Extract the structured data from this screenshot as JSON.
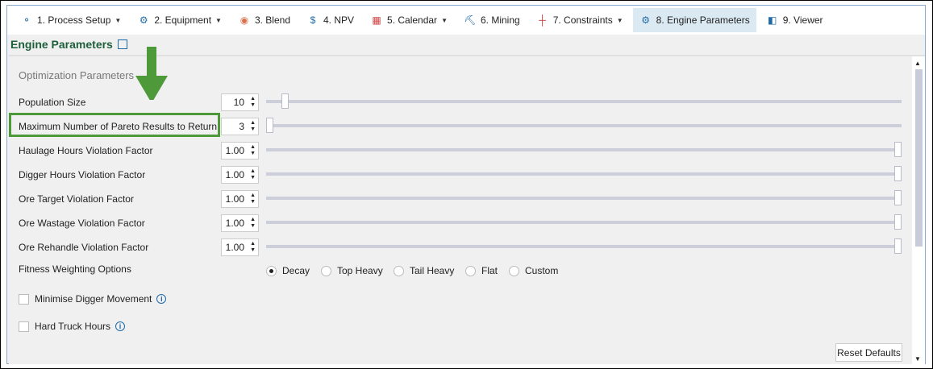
{
  "tabs": [
    {
      "label": "1. Process Setup",
      "icon": "process-icon",
      "dropdown": true
    },
    {
      "label": "2. Equipment",
      "icon": "equipment-icon",
      "dropdown": true
    },
    {
      "label": "3. Blend",
      "icon": "blend-icon",
      "dropdown": false
    },
    {
      "label": "4. NPV",
      "icon": "dollar-icon",
      "dropdown": false
    },
    {
      "label": "5. Calendar",
      "icon": "calendar-icon",
      "dropdown": true
    },
    {
      "label": "6. Mining",
      "icon": "mining-icon",
      "dropdown": false
    },
    {
      "label": "7. Constraints",
      "icon": "constraints-icon",
      "dropdown": true
    },
    {
      "label": "8. Engine Parameters",
      "icon": "gear-icon",
      "dropdown": false,
      "active": true
    },
    {
      "label": "9. Viewer",
      "icon": "viewer-icon",
      "dropdown": false
    }
  ],
  "header": {
    "title": "Engine Parameters"
  },
  "section_title": "Optimization Parameters",
  "params": [
    {
      "label": "Population Size",
      "value": "10",
      "slider_fraction": 0.025
    },
    {
      "label": "Maximum Number of Pareto Results to Return",
      "value": "3",
      "slider_fraction": 0.0
    },
    {
      "label": "Haulage Hours Violation Factor",
      "value": "1.00",
      "slider_fraction": 1.0
    },
    {
      "label": "Digger Hours Violation Factor",
      "value": "1.00",
      "slider_fraction": 1.0
    },
    {
      "label": "Ore Target Violation Factor",
      "value": "1.00",
      "slider_fraction": 1.0
    },
    {
      "label": "Ore Wastage Violation Factor",
      "value": "1.00",
      "slider_fraction": 1.0
    },
    {
      "label": "Ore Rehandle Violation Factor",
      "value": "1.00",
      "slider_fraction": 1.0
    }
  ],
  "fitness": {
    "label": "Fitness Weighting Options",
    "options": [
      "Decay",
      "Top Heavy",
      "Tail Heavy",
      "Flat",
      "Custom"
    ],
    "selected": "Decay"
  },
  "checkboxes": [
    {
      "label": "Minimise Digger Movement",
      "checked": false
    },
    {
      "label": "Hard Truck Hours",
      "checked": false
    }
  ],
  "reset_label": "Reset Defaults",
  "colors": {
    "highlight": "#4e9a3a",
    "header": "#1e5e3a",
    "active_tab": "#dbe9f2"
  }
}
